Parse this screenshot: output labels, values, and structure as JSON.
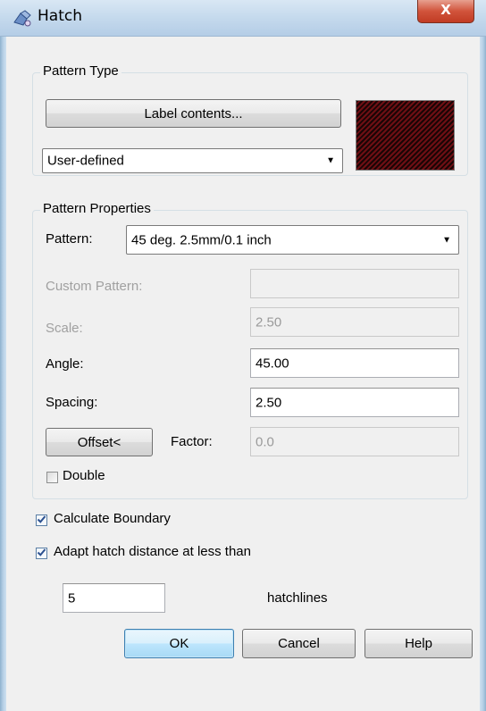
{
  "window": {
    "title": "Hatch",
    "close_glyph": "X"
  },
  "pattern_type": {
    "group_label": "Pattern Type",
    "label_contents_button": "Label contents...",
    "type_select": {
      "value": "User-defined"
    },
    "preview": {
      "colors": [
        "#6e0f14",
        "#1a0505"
      ],
      "stripe_angle_deg": 45
    }
  },
  "pattern_properties": {
    "group_label": "Pattern Properties",
    "pattern": {
      "label": "Pattern:",
      "value": "45 deg. 2.5mm/0.1 inch"
    },
    "custom_pattern": {
      "label": "Custom Pattern:",
      "value": ""
    },
    "scale": {
      "label": "Scale:",
      "value": "2.50"
    },
    "angle": {
      "label": "Angle:",
      "value": "45.00"
    },
    "spacing": {
      "label": "Spacing:",
      "value": "2.50"
    },
    "offset_button": "Offset<",
    "factor": {
      "label": "Factor:",
      "value": "0.0"
    },
    "double": {
      "label": "Double",
      "checked": false
    }
  },
  "calculate_boundary": {
    "label": "Calculate Boundary",
    "checked": true
  },
  "adapt_hatch": {
    "label": "Adapt hatch distance at less than",
    "checked": true
  },
  "hatchlines": {
    "value": "5",
    "unit_label": "hatchlines"
  },
  "buttons": {
    "ok": "OK",
    "cancel": "Cancel",
    "help": "Help"
  },
  "icons": {
    "app": "hatch-app-icon",
    "close": "close-icon",
    "dropdown": "chevron-down-icon",
    "checkbox": "checkmark-icon"
  },
  "colors": {
    "checkmark": "#2a4f8f",
    "primary_button_border": "#3c7fb1"
  }
}
